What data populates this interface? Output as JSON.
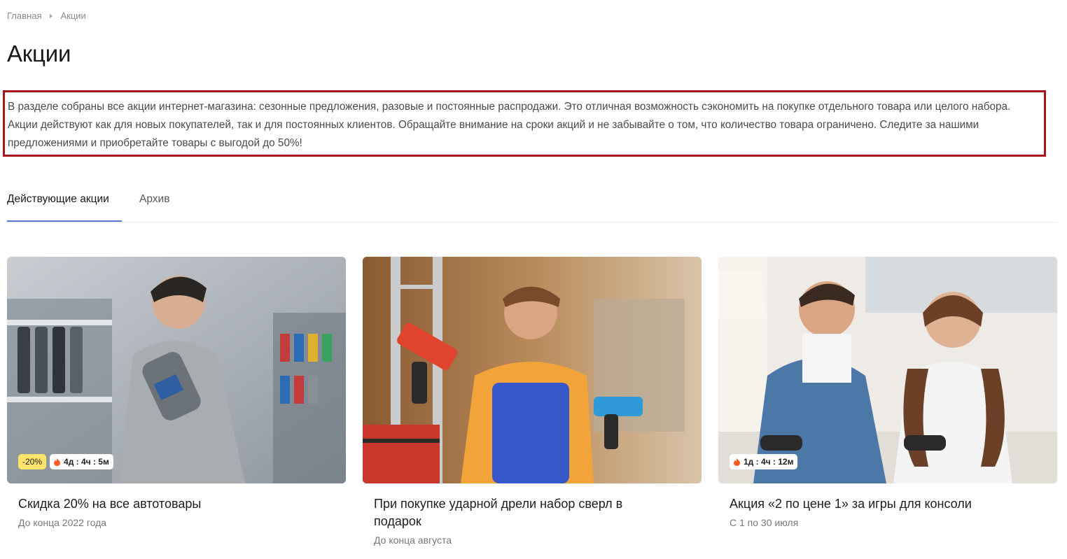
{
  "breadcrumb": {
    "home": "Главная",
    "current": "Акции"
  },
  "page": {
    "title": "Акции",
    "intro": "В разделе собраны все акции интернет-магазина: сезонные предложения, разовые и постоянные распродажи. Это отличная возможность сэкономить на покупке отдельного товара или целого набора. Акции действуют как для новых покупателей, так и для постоянных клиентов. Обращайте внимание на сроки акций и не забывайте о том, что количество товара ограничено. Следите за нашими предложениями и приобретайте товары с выгодой до 50%!"
  },
  "tabs": [
    {
      "label": "Действующие акции",
      "active": true
    },
    {
      "label": "Архив",
      "active": false
    }
  ],
  "promos": [
    {
      "title": "Скидка 20% на все автотовары",
      "date": "До конца 2022 года",
      "discount": "-20%",
      "timer": "4д : 4ч : 5м"
    },
    {
      "title": "При покупке ударной дрели набор сверл в подарок",
      "date": "До конца августа"
    },
    {
      "title": "Акция «2 по цене 1» за игры для консоли",
      "date": "С 1 по 30 июля",
      "timer": "1д : 4ч : 12м"
    }
  ],
  "colors": {
    "accent": "#5b7bd5",
    "highlight_border": "#a7141b",
    "sale_badge": "#ffe46b",
    "fire_icon": "#ff5a1f"
  }
}
